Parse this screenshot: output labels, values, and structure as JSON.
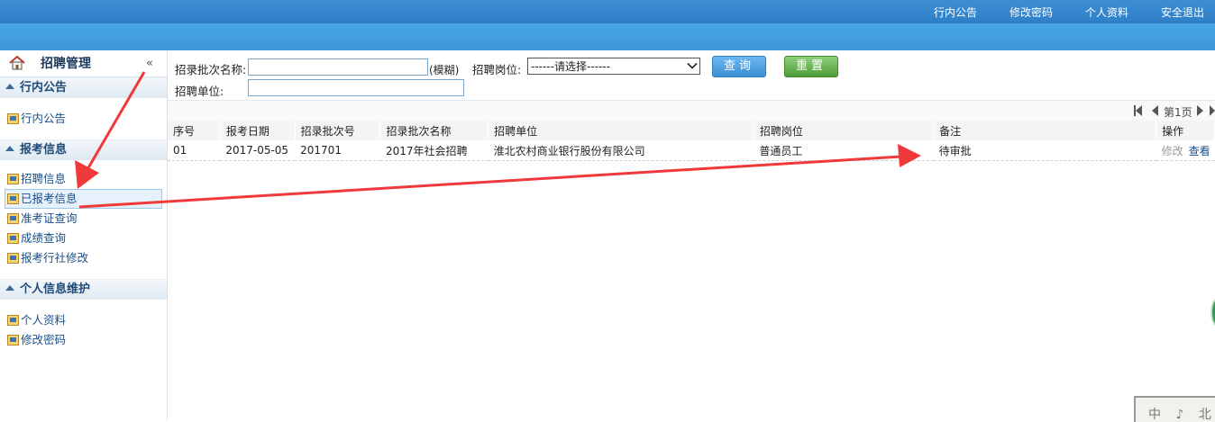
{
  "topnav": [
    "行内公告",
    "修改密码",
    "个人资料",
    "安全退出"
  ],
  "sidebar": {
    "title": "招聘管理",
    "collapse": "«",
    "sections": [
      {
        "head": "行内公告",
        "items": [
          "行内公告"
        ]
      },
      {
        "head": "报考信息",
        "items": [
          "招聘信息",
          "已报考信息",
          "准考证查询",
          "成绩查询",
          "报考行社修改"
        ]
      },
      {
        "head": "个人信息维护",
        "items": [
          "个人资料",
          "修改密码"
        ]
      }
    ],
    "active_item": "已报考信息"
  },
  "filters": {
    "batch_name_label": "招录批次名称:",
    "batch_name_value": "",
    "fuzzy_hint": "(模糊)",
    "position_label": "招聘岗位:",
    "position_selected": "------请选择------",
    "unit_label": "招聘单位:",
    "unit_value": "",
    "query_button": "查询",
    "reset_button": "重置"
  },
  "pager": {
    "page_text": "第1页"
  },
  "table": {
    "columns": [
      "序号",
      "报考日期",
      "招录批次号",
      "招录批次名称",
      "招聘单位",
      "招聘岗位",
      "备注",
      "操作"
    ],
    "rows": [
      {
        "seq": "01",
        "date": "2017-05-05",
        "batch_no": "201701",
        "batch_name": "2017年社会招聘",
        "unit": "淮北农村商业银行股份有限公司",
        "position": "普通员工",
        "remark": "待审批",
        "op_edit": "修改",
        "op_view": "查看"
      }
    ]
  },
  "seal_text": "中 ♪ 北",
  "colors": {
    "topbar": "#2f7fc8",
    "banner": "#3d97d9",
    "annotation_arrow": "#f0393b",
    "link": "#1a4f8a"
  }
}
